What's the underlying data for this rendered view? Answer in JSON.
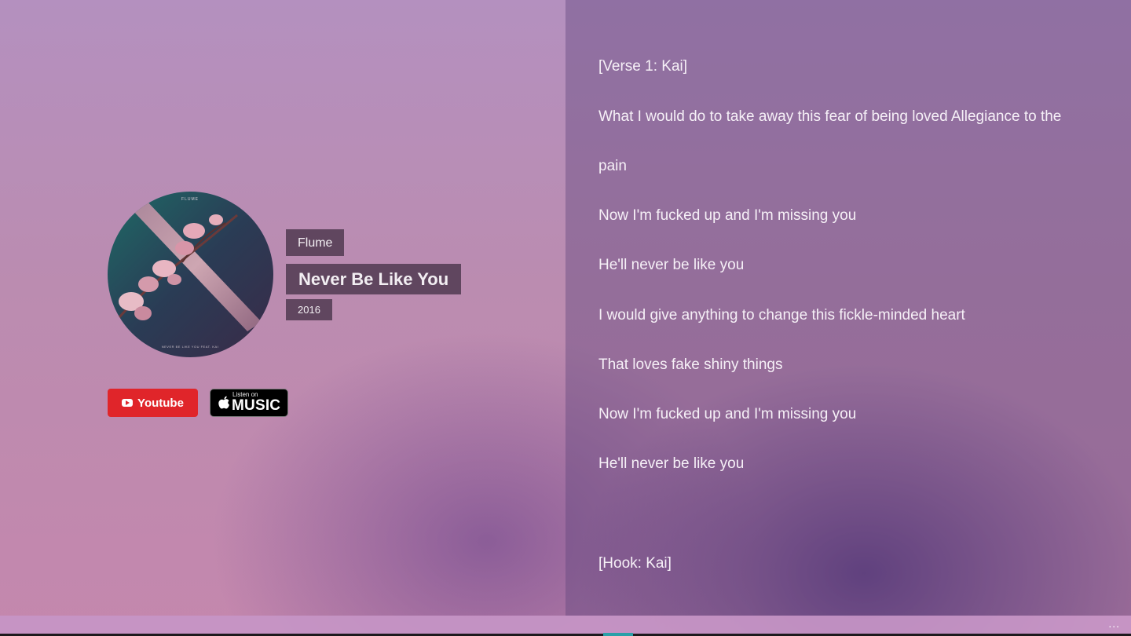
{
  "song": {
    "artist": "Flume",
    "title": "Never Be Like You",
    "year": "2016",
    "album_art": {
      "top_text": "FLUME",
      "bottom_text": "NEVER BE LIKE YOU FEAT. KAI"
    }
  },
  "buttons": {
    "youtube_label": "Youtube",
    "apple_music_small": "Listen on",
    "apple_music_label": "MUSIC"
  },
  "lyrics": [
    "[Verse 1: Kai]",
    "What I would do to take away this fear of being loved Allegiance to the",
    "pain",
    "Now I'm fucked up and I'm missing you",
    "He'll never be like you",
    "I would give anything to change this fickle-minded heart",
    "That loves fake shiny things",
    "Now I'm fucked up and I'm missing you",
    "He'll never be like you",
    "",
    "[Hook: Kai]"
  ],
  "bottom_bar": {
    "more_label": "..."
  },
  "colors": {
    "youtube_red": "#e0252a",
    "chip_background": "#46324a",
    "accent_teal": "#2aa0a8"
  }
}
